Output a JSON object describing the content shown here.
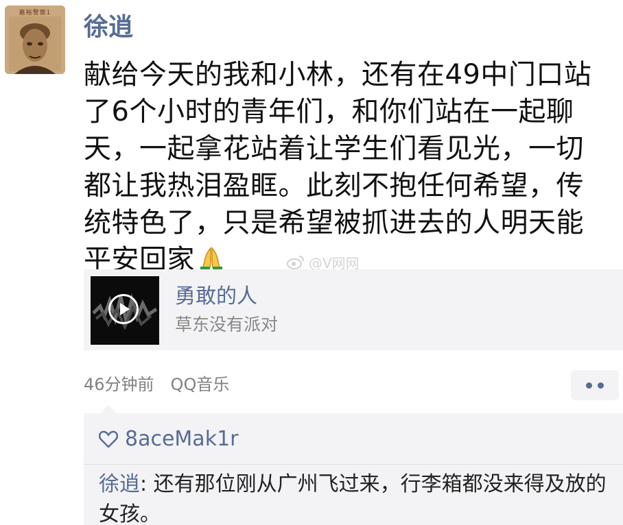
{
  "post": {
    "author": "徐逍",
    "avatar_caption": "嘉裕警察1",
    "text": "献给今天的我和小林，还有在49中门口站了6个小时的青年们，和你们站在一起聊天，一起拿花站着让学生们看见光，一切都让我热泪盈眶。此刻不抱任何希望，传统特色了，只是希望被抓进去的人明天能平安回家",
    "emoji": "folded-hands"
  },
  "watermark": "@V网网",
  "music": {
    "title": "勇敢的人",
    "artist": "草东没有派对"
  },
  "meta": {
    "time": "46分钟前",
    "source": "QQ音乐"
  },
  "comments": {
    "liked_by": "8aceMak1r",
    "items": [
      {
        "author": "徐逍",
        "separator": ": ",
        "text": "还有那位刚从广州飞过来，行李箱都没来得及放的女孩。"
      }
    ]
  },
  "colors": {
    "link": "#576b95",
    "card_bg": "#f3f3f5",
    "text": "#111111",
    "meta": "#808080"
  }
}
